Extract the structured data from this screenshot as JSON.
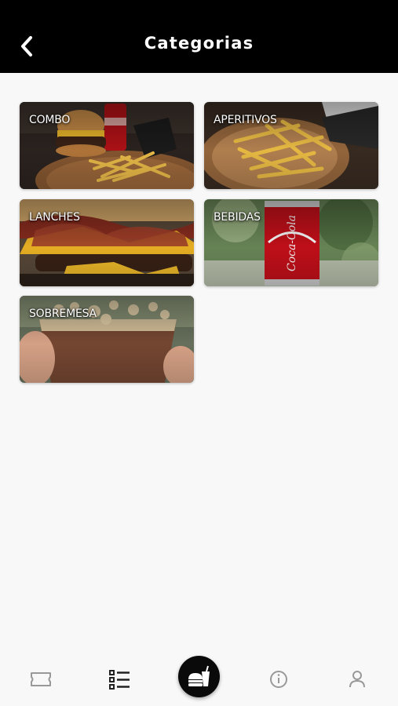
{
  "header": {
    "title": "Categorias",
    "back_icon": "chevron-left-icon"
  },
  "categories": [
    {
      "label": "COMBO"
    },
    {
      "label": "APERITIVOS"
    },
    {
      "label": "LANCHES"
    },
    {
      "label": "BEBIDAS"
    },
    {
      "label": "SOBREMESA"
    }
  ],
  "bottom_nav": {
    "items": [
      {
        "icon": "ticket-icon"
      },
      {
        "icon": "list-icon"
      },
      {
        "icon": "burger-drink-icon"
      },
      {
        "icon": "info-icon"
      },
      {
        "icon": "user-icon"
      }
    ]
  },
  "colors": {
    "header_bg": "#000000",
    "page_bg": "#f8f8f8",
    "active_icon": "#222222",
    "inactive_icon": "#999999"
  }
}
